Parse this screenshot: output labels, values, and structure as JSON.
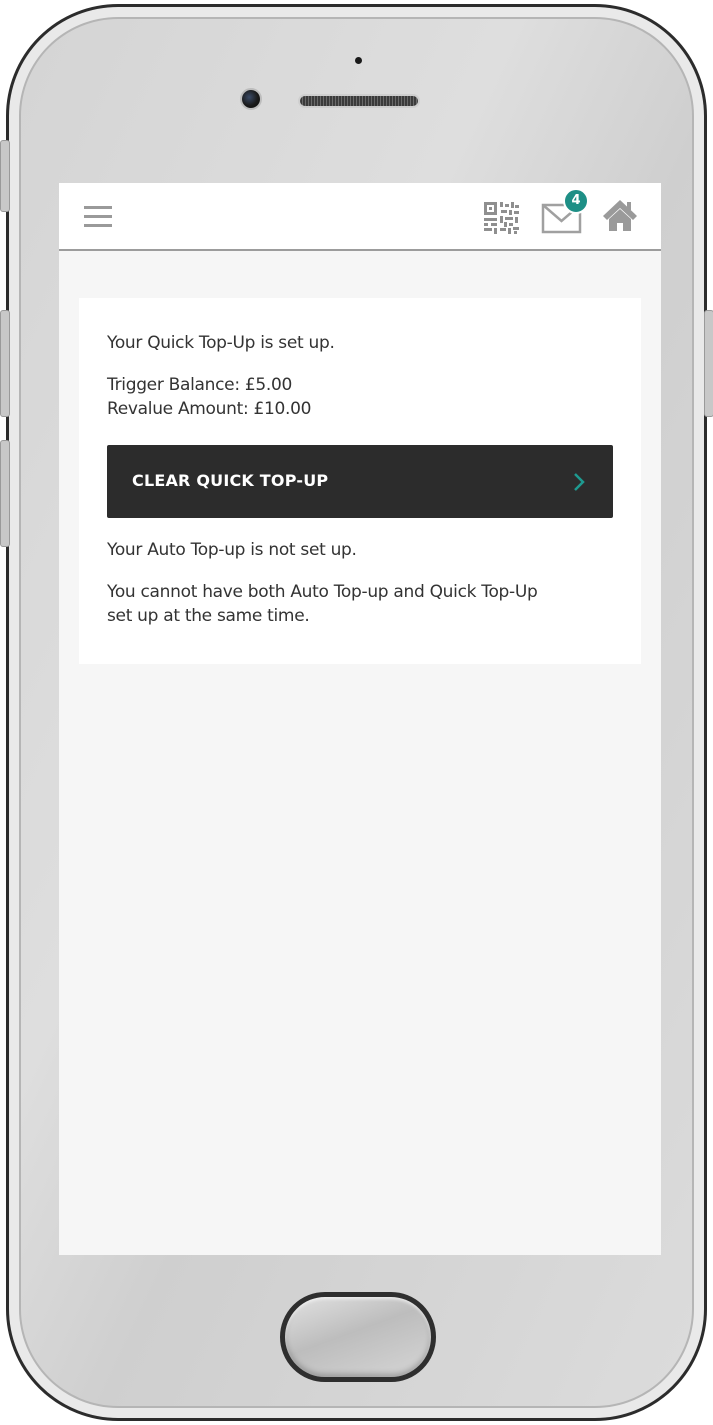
{
  "header": {
    "menu_icon": "hamburger-menu-icon",
    "qr_icon": "qr-code-icon",
    "messages_icon": "envelope-icon",
    "messages_badge": "4",
    "home_icon": "home-icon",
    "accent_color": "#1e8f86"
  },
  "quick_topup": {
    "status_text": "Your Quick Top-Up is set up.",
    "trigger_balance": "Trigger Balance: £5.00",
    "revalue_amount": "Revalue Amount: £10.00",
    "clear_button_label": "CLEAR QUICK TOP-UP",
    "clear_button_icon": "chevron-right-icon"
  },
  "auto_topup": {
    "status_text": "Your Auto Top-up is not set up.",
    "notice_line1": "You cannot have both Auto Top-up and Quick Top-Up",
    "notice_line2": "set up at the same time."
  }
}
